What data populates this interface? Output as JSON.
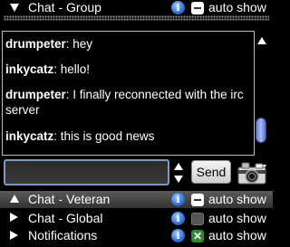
{
  "panels": [
    {
      "label": "Chat - Group",
      "auto_show": "auto show",
      "expanded": true,
      "toggle": "white"
    },
    {
      "label": "Chat - Veteran",
      "auto_show": "auto show",
      "expanded": true,
      "selected": true,
      "toggle": "white"
    },
    {
      "label": "Chat - Global",
      "auto_show": "auto show",
      "expanded": false,
      "toggle": "dark"
    },
    {
      "label": "Notifications",
      "auto_show": "auto show",
      "expanded": false,
      "toggle": "green",
      "toggle_glyph": "✕"
    }
  ],
  "messages": [
    {
      "user": "drumpeter",
      "text": ": hey"
    },
    {
      "user": "inkycatz",
      "text": ": hello!"
    },
    {
      "user": "drumpeter",
      "text": ": I finally reconnected with the irc server"
    },
    {
      "user": "inkycatz",
      "text": ": this is good news"
    }
  ],
  "composer": {
    "value": "",
    "send_label": "Send"
  },
  "info_glyph": "i",
  "colors": {
    "selected_row": "#4a4a4a",
    "input_border": "#7a9bbd",
    "info_blue": "#2e6fd6",
    "scroll_thumb": "#8fa0f0"
  }
}
